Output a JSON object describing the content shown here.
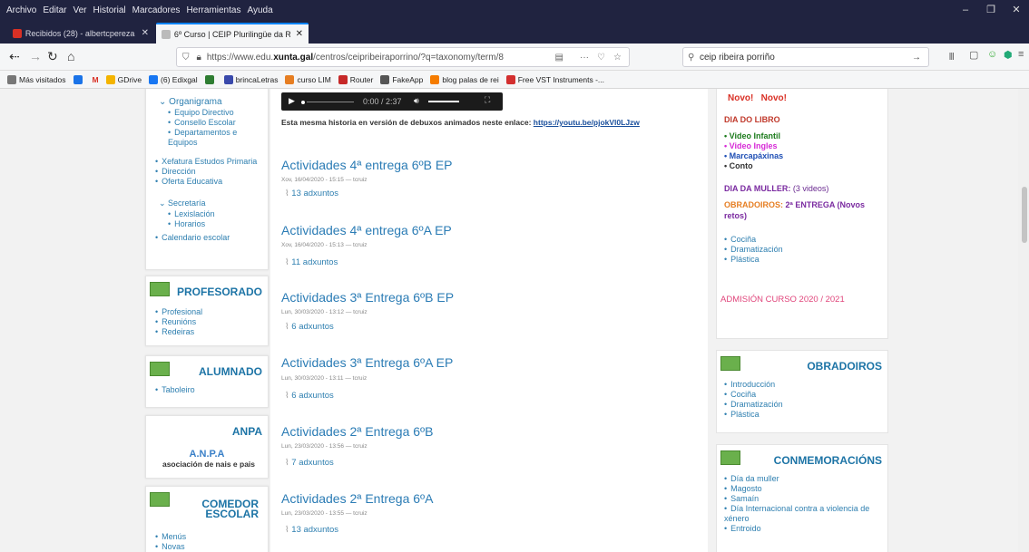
{
  "menu": [
    "Archivo",
    "Editar",
    "Ver",
    "Historial",
    "Marcadores",
    "Herramientas",
    "Ayuda"
  ],
  "window_controls": {
    "minimize": "–",
    "restore": "❐",
    "close": "✕"
  },
  "tabs": [
    {
      "label": "Recibidos (28) - albertcpereza",
      "favicon_color": "#d93025"
    },
    {
      "label": "6º Curso | CEIP Plurilingüe da Ribei",
      "favicon_color": "#bbbbbb"
    }
  ],
  "new_tab": "+",
  "url": {
    "prefix": "https://www.edu.",
    "domain": "xunta.gal",
    "path": "/centros/ceipribeiraporrino/?q=taxonomy/term/8"
  },
  "search_value": "ceip ribeira porriño",
  "bookmarks": [
    {
      "label": "Más visitados",
      "color": "#777"
    },
    {
      "label": "",
      "color": "#1a73e8"
    },
    {
      "label": "M",
      "color": "#d93025"
    },
    {
      "label": "GDrive",
      "color": "#f4b400"
    },
    {
      "label": "(6) Edixgal",
      "color": "#1877f2"
    },
    {
      "label": "",
      "color": "#2e7d32"
    },
    {
      "label": "brincaLetras",
      "color": "#3949ab"
    },
    {
      "label": "curso LIM",
      "color": "#e67e22"
    },
    {
      "label": "Router",
      "color": "#c62828"
    },
    {
      "label": "FakeApp",
      "color": "#555"
    },
    {
      "label": "blog palas de rei",
      "color": "#f57c00"
    },
    {
      "label": "Free VST Instruments -...",
      "color": "#d32f2f"
    }
  ],
  "sidebar": {
    "organigrama": {
      "title": "Organigrama",
      "items": [
        "Equipo Directivo",
        "Consello Escolar",
        "Departamentos e Equipos"
      ]
    },
    "top_items": [
      "Xefatura Estudos Primaria",
      "Dirección",
      "Oferta Educativa"
    ],
    "secretaria": {
      "title": "Secretaría",
      "items": [
        "Lexislación",
        "Horarios"
      ]
    },
    "calendario": "Calendario escolar",
    "profesorado": {
      "title": "PROFESORADO",
      "items": [
        "Profesional",
        "Reunións",
        "Redeiras"
      ]
    },
    "alumnado": {
      "title": "ALUMNADO",
      "items": [
        "Taboleiro"
      ]
    },
    "anpa": {
      "title": "ANPA",
      "logo_text": "A.N.P.A",
      "logo_sub": "asociación de nais e pais"
    },
    "comedor": {
      "title": "COMEDOR ESCOLAR",
      "items": [
        "Menús",
        "Novas"
      ]
    }
  },
  "main": {
    "audio": {
      "time": "0:00 / 2:37"
    },
    "intro_text": "Esta mesma historia en versión de debuxos animados neste enlace:",
    "intro_link": "https://youtu.be/pjokVl0LJzw",
    "entries": [
      {
        "title": "Actividades 4ª entrega 6ºB EP",
        "meta": "Xov, 16/04/2020 - 15:15 — tcruiz",
        "attach": "13 adxuntos"
      },
      {
        "title": "Actividades 4ª entrega 6ºA EP",
        "meta": "Xov, 16/04/2020 - 15:13 — tcruiz",
        "attach": "11 adxuntos"
      },
      {
        "title": "Actividades 3ª Entrega 6ºB EP",
        "meta": "Lun, 30/03/2020 - 13:12 — tcruiz",
        "attach": "6 adxuntos"
      },
      {
        "title": "Actividades 3ª Entrega 6ºA EP",
        "meta": "Lun, 30/03/2020 - 13:11 — tcruiz",
        "attach": "6 adxuntos"
      },
      {
        "title": "Actividades 2ª Entrega 6ºB",
        "meta": "Lun, 23/03/2020 - 13:56 — tcruiz",
        "attach": "7 adxuntos"
      },
      {
        "title": "Actividades 2ª Entrega 6ºA",
        "meta": "Lun, 23/03/2020 - 13:55 — tcruiz",
        "attach": "13 adxuntos"
      }
    ]
  },
  "right": {
    "novo": "Novo!   Novo!",
    "dia_libro": "DIA DO LIBRO",
    "dia_libro_items": [
      {
        "label": "Video Infantil",
        "color": "#1a7a1a"
      },
      {
        "label": "Video Ingles",
        "color": "#d62ad6"
      },
      {
        "label": "Marcapáxinas",
        "color": "#1f4fb5"
      },
      {
        "label": "Conto",
        "color": "#333333"
      }
    ],
    "dia_muller_label": "DIA DA MULLER:",
    "dia_muller_extra": "(3 videos)",
    "obradoiros_label": "OBRADOIROS:",
    "obradoiros_extra": "2ª ENTREGA (Novos retos)",
    "obradoiros_items": [
      "Cociña",
      "Dramatización",
      "Plástica"
    ],
    "admision": "ADMISIÓN CURSO 2020 / 2021",
    "obradoiros_block": {
      "title": "OBRADOIROS",
      "items": [
        "Introducción",
        "Cociña",
        "Dramatización",
        "Plástica"
      ]
    },
    "conmemoracions": {
      "title": "CONMEMORACIÓNS",
      "items": [
        "Día da muller",
        "Magosto",
        "Samaín",
        "Día Internacional contra a violencia de xénero",
        "Entroido"
      ]
    }
  }
}
